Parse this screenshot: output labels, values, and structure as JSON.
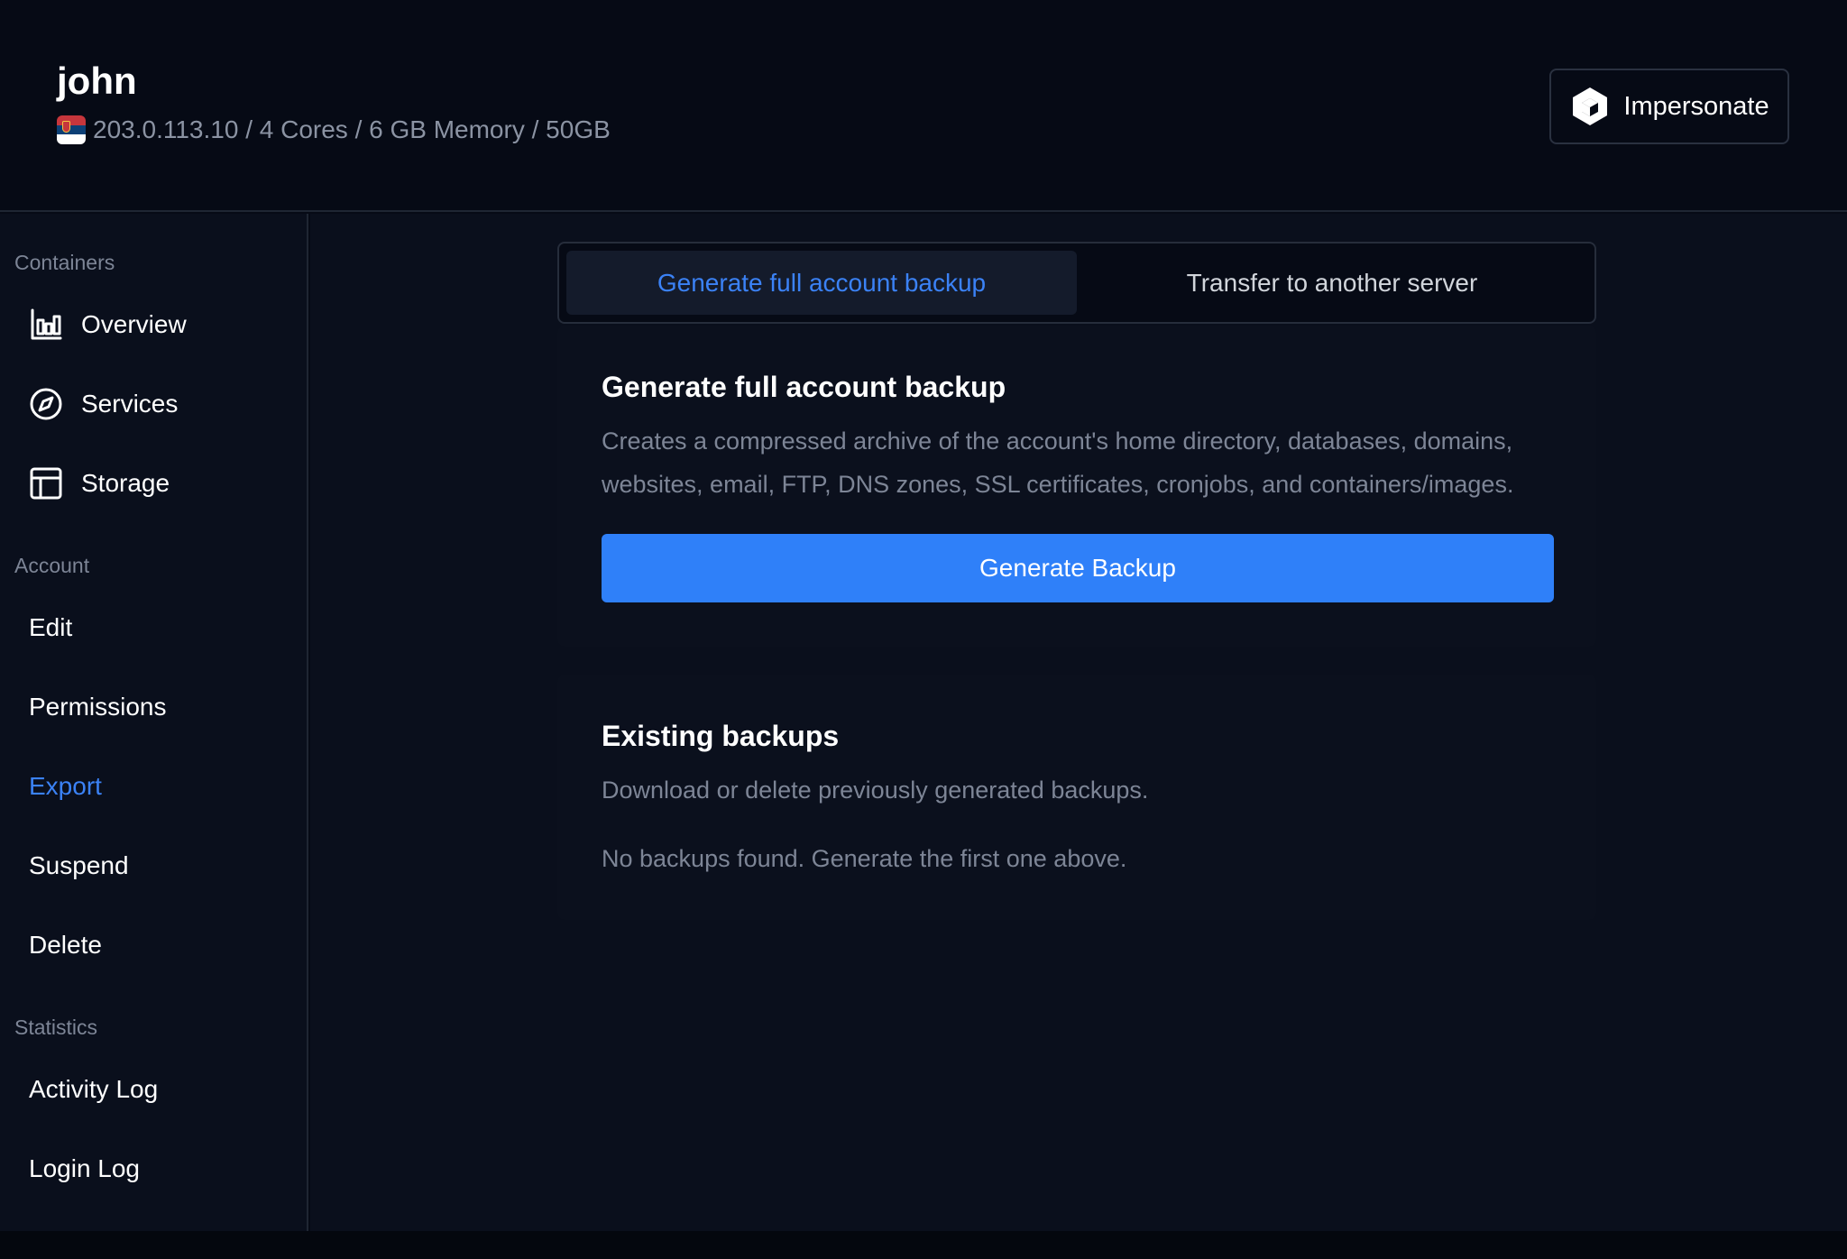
{
  "header": {
    "account_name": "john",
    "server_info": "203.0.113.10 / 4 Cores / 6 GB Memory / 50GB",
    "flag_icon": "serbia-flag",
    "impersonate_label": "Impersonate"
  },
  "sidebar": {
    "containers_title": "Containers",
    "containers_items": [
      {
        "label": "Overview",
        "icon": "bar-chart-icon"
      },
      {
        "label": "Services",
        "icon": "compass-icon"
      },
      {
        "label": "Storage",
        "icon": "table-icon"
      }
    ],
    "account_title": "Account",
    "account_items": [
      {
        "label": "Edit"
      },
      {
        "label": "Permissions"
      },
      {
        "label": "Export",
        "active": true
      },
      {
        "label": "Suspend"
      },
      {
        "label": "Delete"
      }
    ],
    "statistics_title": "Statistics",
    "statistics_items": [
      {
        "label": "Activity Log"
      },
      {
        "label": "Login Log"
      }
    ]
  },
  "tabs": [
    {
      "label": "Generate full account backup",
      "active": true
    },
    {
      "label": "Transfer to another server",
      "active": false
    }
  ],
  "backup_card": {
    "title": "Generate full account backup",
    "description": "Creates a compressed archive of the account's home directory, databases, domains, websites, email, FTP, DNS zones, SSL certificates, cronjobs, and containers/images.",
    "button_label": "Generate Backup"
  },
  "existing_card": {
    "title": "Existing backups",
    "description": "Download or delete previously generated backups.",
    "empty_message": "No backups found. Generate the first one above."
  },
  "colors": {
    "accent": "#3b82f6",
    "button": "#2f80f9",
    "background": "#060a15"
  }
}
